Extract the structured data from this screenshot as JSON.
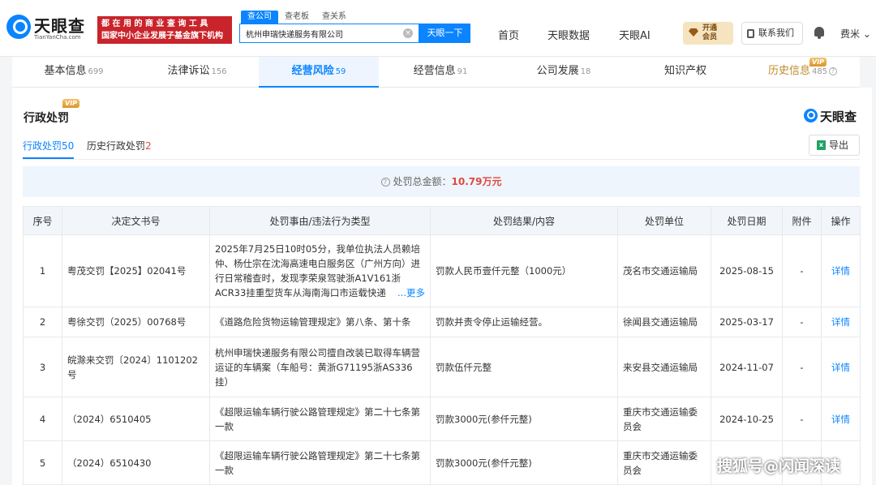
{
  "header": {
    "logo_text": "天眼查",
    "logo_sub": "TianYanCha.com",
    "promo_line1": "都 在 用 的 商 业 查 询 工 具",
    "promo_line2": "国家中小企业发展子基金旗下机构",
    "search_tabs": [
      "查公司",
      "查老板",
      "查关系"
    ],
    "search_value": "杭州申瑞快递服务有限公司",
    "search_button": "天眼一下",
    "nav": [
      "首页",
      "天眼数据",
      "天眼AI"
    ],
    "vip_line1": "开通",
    "vip_line2": "会员",
    "contact": "联系我们",
    "user": "费米"
  },
  "tabs": [
    {
      "label": "基本信息",
      "count": "699"
    },
    {
      "label": "法律诉讼",
      "count": "156"
    },
    {
      "label": "经营风险",
      "count": "59"
    },
    {
      "label": "经营信息",
      "count": "91"
    },
    {
      "label": "公司发展",
      "count": "18"
    },
    {
      "label": "知识产权",
      "count": ""
    },
    {
      "label": "历史信息",
      "count": "485"
    }
  ],
  "vip_tag": "VIP",
  "section": {
    "title": "行政处罚",
    "brand": "天眼查",
    "subtabs": [
      {
        "label": "行政处罚",
        "count": "50"
      },
      {
        "label": "历史行政处罚",
        "count": "2"
      }
    ],
    "export": "导出",
    "summary_label": "处罚总金额：",
    "summary_amount": "10.79万元"
  },
  "table": {
    "headers": [
      "序号",
      "决定文书号",
      "处罚事由/违法行为类型",
      "处罚结果/内容",
      "处罚单位",
      "处罚日期",
      "附件",
      "操作"
    ],
    "more_label": "...更多",
    "rows": [
      {
        "no": "1",
        "doc": "粤茂交罚【2025】02041号",
        "reason": "2025年7月25日10时05分，我单位执法人员赖培仲、杨仕宗在沈海高速电白服务区（广州方向）进行日常稽查时，发现李荣泉驾驶浙A1V161浙ACR33挂重型货车从海南海口市运载快递",
        "result": "罚款人民币壹仟元整（1000元）",
        "unit": "茂名市交通运输局",
        "date": "2025-08-15",
        "attach": "-",
        "action": "详情"
      },
      {
        "no": "2",
        "doc": "粤徐交罚（2025）00768号",
        "reason": "《道路危险货物运输管理规定》第八条、第十条",
        "result": "罚款并责令停止运输经营。",
        "unit": "徐闻县交通运输局",
        "date": "2025-03-17",
        "attach": "-",
        "action": "详情"
      },
      {
        "no": "3",
        "doc": "皖滁来交罚〔2024〕1101202号",
        "reason": "杭州申瑞快递服务有限公司擅自改装已取得车辆营运证的车辆案（车船号：黄浙G71195浙AS336挂）",
        "result": "罚款伍仟元整",
        "unit": "来安县交通运输局",
        "date": "2024-11-07",
        "attach": "-",
        "action": "详情"
      },
      {
        "no": "4",
        "doc": "（2024）6510405",
        "reason": "《超限运输车辆行驶公路管理规定》第二十七条第一款",
        "result": "罚款3000元(参仟元整)",
        "unit": "重庆市交通运输委员会",
        "date": "2024-10-25",
        "attach": "-",
        "action": "详情"
      },
      {
        "no": "5",
        "doc": "（2024）6510430",
        "reason": "《超限运输车辆行驶公路管理规定》第二十七条第一款",
        "result": "罚款3000元(参仟元整)",
        "unit": "重庆市交通运输委员会",
        "date": "",
        "attach": "",
        "action": ""
      }
    ]
  },
  "watermark": "搜狐号@闪闻深读"
}
